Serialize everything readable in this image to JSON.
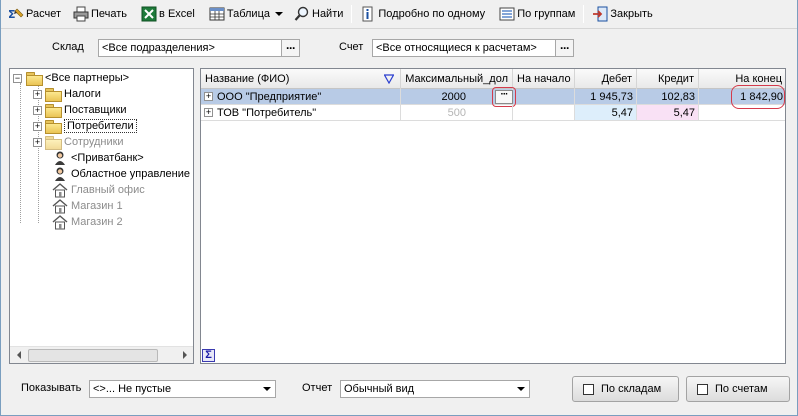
{
  "toolbar": {
    "calc_label": "Расчет",
    "print_label": "Печать",
    "excel_label": "в Excel",
    "table_label": "Таблица",
    "find_label": "Найти",
    "detail_label": "Подробно по одному",
    "groups_label": "По группам",
    "close_label": "Закрыть"
  },
  "filters": {
    "warehouse_label": "Склад",
    "warehouse_value": "<Все подразделения>",
    "account_label": "Счет",
    "account_value": "<Все относящиеся к расчетам>"
  },
  "tree": {
    "root": "<Все партнеры>",
    "items": [
      "Налоги",
      "Поставщики",
      "Потребители",
      "Сотрудники",
      "<Приватбанк>",
      "Областное управление (",
      "Главный офис",
      "Магазин 1",
      "Магазин 2"
    ]
  },
  "grid": {
    "headers": [
      "Название (ФИО)",
      "Максимальный_дол",
      "На начало",
      "Дебет",
      "Кредит",
      "На конец"
    ],
    "rows": [
      {
        "name": "ООО \"Предприятие\"",
        "max_debt": "2000",
        "start": "",
        "debit": "1 945,73",
        "credit": "102,83",
        "end": "1 842,90"
      },
      {
        "name": "ТОВ \"Потребитель\"",
        "max_debt": "500",
        "start": "",
        "debit": "5,47",
        "credit": "5,47",
        "end": ""
      }
    ]
  },
  "bottom": {
    "show_label": "Показывать",
    "show_value": "<>...  Не пустые",
    "report_label": "Отчет",
    "report_value": "Обычный вид",
    "by_warehouses_label": "По складам",
    "by_accounts_label": "По счетам"
  },
  "colors": {
    "selected_row": "#b8cbe6",
    "debit_bg": "#ddeefb",
    "credit_bg": "#f9e1f5",
    "annotation": "#d43a4b"
  }
}
